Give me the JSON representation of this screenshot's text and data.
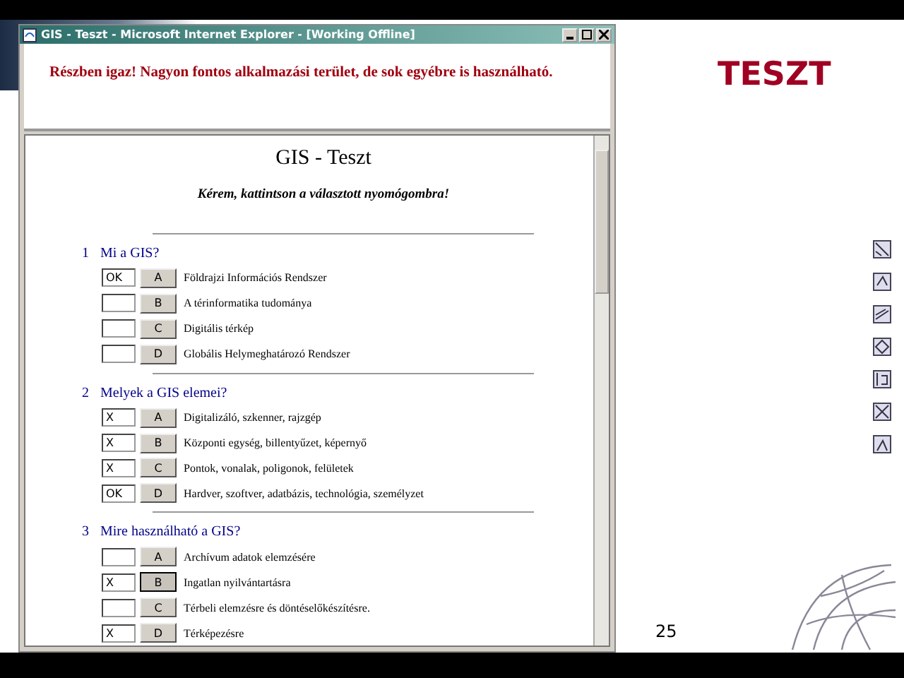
{
  "slide": {
    "title": "TESZT",
    "page_number": "25"
  },
  "window": {
    "title": "GIS - Teszt - Microsoft Internet Explorer - [Working Offline]"
  },
  "feedback": "Részben igaz! Nagyon fontos alkalmazási terület, de sok egyébre is használható.",
  "page": {
    "heading": "GIS - Teszt",
    "instruction": "Kérem, kattintson a választott nyomógombra!"
  },
  "questions": [
    {
      "number": "1",
      "text": "Mi a GIS?",
      "answers": [
        {
          "mark": "OK",
          "letter": "A",
          "text": "Földrajzi Információs Rendszer",
          "selected": false
        },
        {
          "letter": "B",
          "text": "A térinformatika tudománya",
          "selected": false
        },
        {
          "letter": "C",
          "text": "Digitális térkép",
          "selected": false
        },
        {
          "letter": "D",
          "text": "Globális Helymeghatározó Rendszer",
          "selected": false
        }
      ]
    },
    {
      "number": "2",
      "text": "Melyek a GIS elemei?",
      "answers": [
        {
          "mark": "X",
          "letter": "A",
          "text": "Digitalizáló, szkenner, rajzgép",
          "selected": false
        },
        {
          "mark": "X",
          "letter": "B",
          "text": "Központi egység, billentyűzet, képernyő",
          "selected": false
        },
        {
          "mark": "X",
          "letter": "C",
          "text": "Pontok, vonalak, poligonok, felületek",
          "selected": false
        },
        {
          "mark": "OK",
          "letter": "D",
          "text": "Hardver, szoftver, adatbázis, technológia, személyzet",
          "selected": false
        }
      ]
    },
    {
      "number": "3",
      "text": "Mire használható a GIS?",
      "answers": [
        {
          "letter": "A",
          "text": "Archívum adatok elemzésére",
          "selected": false
        },
        {
          "mark": "X",
          "letter": "B",
          "text": "Ingatlan nyilvántartásra",
          "selected": true
        },
        {
          "letter": "C",
          "text": "Térbeli elemzésre és döntéselőkészítésre.",
          "selected": false
        },
        {
          "mark": "X",
          "letter": "D",
          "text": "Térképezésre",
          "selected": false
        }
      ]
    }
  ]
}
